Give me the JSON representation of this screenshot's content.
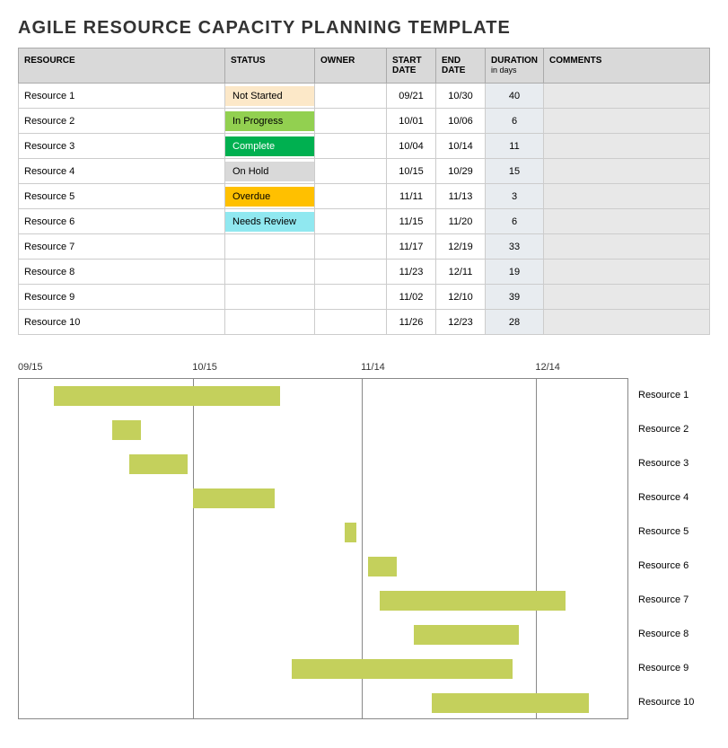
{
  "title": "AGILE RESOURCE CAPACITY PLANNING TEMPLATE",
  "headers": {
    "resource": "RESOURCE",
    "status": "STATUS",
    "owner": "OWNER",
    "start": "START DATE",
    "end": "END DATE",
    "duration": "DURATION",
    "duration_sub": "in days",
    "comments": "COMMENTS"
  },
  "rows": [
    {
      "resource": "Resource 1",
      "status": "Not Started",
      "status_class": "status-not-started",
      "owner": "",
      "start": "09/21",
      "end": "10/30",
      "duration": "40",
      "comments": ""
    },
    {
      "resource": "Resource 2",
      "status": "In Progress",
      "status_class": "status-in-progress",
      "owner": "",
      "start": "10/01",
      "end": "10/06",
      "duration": "6",
      "comments": ""
    },
    {
      "resource": "Resource 3",
      "status": "Complete",
      "status_class": "status-complete",
      "owner": "",
      "start": "10/04",
      "end": "10/14",
      "duration": "11",
      "comments": ""
    },
    {
      "resource": "Resource 4",
      "status": "On Hold",
      "status_class": "status-on-hold",
      "owner": "",
      "start": "10/15",
      "end": "10/29",
      "duration": "15",
      "comments": ""
    },
    {
      "resource": "Resource 5",
      "status": "Overdue",
      "status_class": "status-overdue",
      "owner": "",
      "start": "11/11",
      "end": "11/13",
      "duration": "3",
      "comments": ""
    },
    {
      "resource": "Resource 6",
      "status": "Needs Review",
      "status_class": "status-needs-review",
      "owner": "",
      "start": "11/15",
      "end": "11/20",
      "duration": "6",
      "comments": ""
    },
    {
      "resource": "Resource 7",
      "status": "",
      "status_class": "",
      "owner": "",
      "start": "11/17",
      "end": "12/19",
      "duration": "33",
      "comments": ""
    },
    {
      "resource": "Resource 8",
      "status": "",
      "status_class": "",
      "owner": "",
      "start": "11/23",
      "end": "12/11",
      "duration": "19",
      "comments": ""
    },
    {
      "resource": "Resource 9",
      "status": "",
      "status_class": "",
      "owner": "",
      "start": "11/02",
      "end": "12/10",
      "duration": "39",
      "comments": ""
    },
    {
      "resource": "Resource 10",
      "status": "",
      "status_class": "",
      "owner": "",
      "start": "11/26",
      "end": "12/23",
      "duration": "28",
      "comments": ""
    }
  ],
  "chart_data": {
    "type": "bar",
    "orientation": "horizontal-gantt",
    "x_axis_ticks": [
      "09/15",
      "10/15",
      "11/14",
      "12/14"
    ],
    "x_range_start": "09/15",
    "x_range_end": "12/30",
    "bar_color": "#c4d05c",
    "series": [
      {
        "name": "Resource 1",
        "start": "09/21",
        "end": "10/30"
      },
      {
        "name": "Resource 2",
        "start": "10/01",
        "end": "10/06"
      },
      {
        "name": "Resource 3",
        "start": "10/04",
        "end": "10/14"
      },
      {
        "name": "Resource 4",
        "start": "10/15",
        "end": "10/29"
      },
      {
        "name": "Resource 5",
        "start": "11/11",
        "end": "11/13"
      },
      {
        "name": "Resource 6",
        "start": "11/15",
        "end": "11/20"
      },
      {
        "name": "Resource 7",
        "start": "11/17",
        "end": "12/19"
      },
      {
        "name": "Resource 8",
        "start": "11/23",
        "end": "12/11"
      },
      {
        "name": "Resource 9",
        "start": "11/02",
        "end": "12/10"
      },
      {
        "name": "Resource 10",
        "start": "11/26",
        "end": "12/23"
      }
    ]
  }
}
